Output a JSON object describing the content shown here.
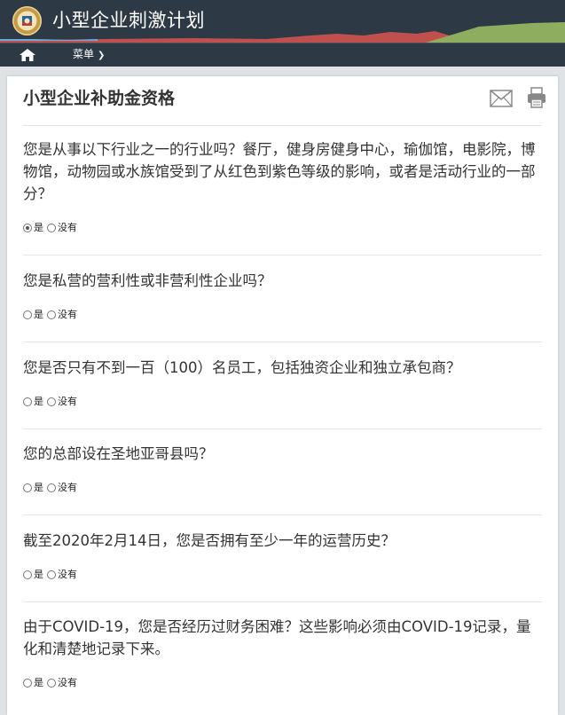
{
  "header": {
    "title": "小型企业刺激计划"
  },
  "nav": {
    "menu_label": "菜单"
  },
  "card": {
    "title": "小型企业补助金资格"
  },
  "questions": [
    {
      "text": "您是从事以下行业之一的行业吗？餐厅，健身房健身中心，瑜伽馆，电影院，博物馆，动物园或水族馆受到了从红色到紫色等级的影响，或者是活动行业的一部分？",
      "yes": "是",
      "no": "没有",
      "selected": "yes"
    },
    {
      "text": "您是私营的营利性或非营利性企业吗？",
      "yes": "是",
      "no": "没有",
      "selected": ""
    },
    {
      "text": "您是否只有不到一百（100）名员工，包括独资企业和独立承包商？",
      "yes": "是",
      "no": "没有",
      "selected": ""
    },
    {
      "text": "您的总部设在圣地亚哥县吗？",
      "yes": "是",
      "no": "没有",
      "selected": ""
    },
    {
      "text": "截至2020年2月14日，您是否拥有至少一年的运营历史？",
      "yes": "是",
      "no": "没有",
      "selected": ""
    },
    {
      "text": "由于COVID-19，您是否经历过财务困难？这些影响必须由COVID-19记录，量化和清楚地记录下来。",
      "yes": "是",
      "no": "没有",
      "selected": ""
    }
  ],
  "icons": {
    "home": "home-icon",
    "menu": "chevron-down-icon",
    "mail": "mail-icon",
    "print": "print-icon",
    "logo": "county-seal"
  },
  "colors": {
    "header_bg": "#2e3946",
    "mountain_red": "#c0504d",
    "mountain_green": "#8fad5f",
    "accent_blue": "#6aa9d8"
  }
}
